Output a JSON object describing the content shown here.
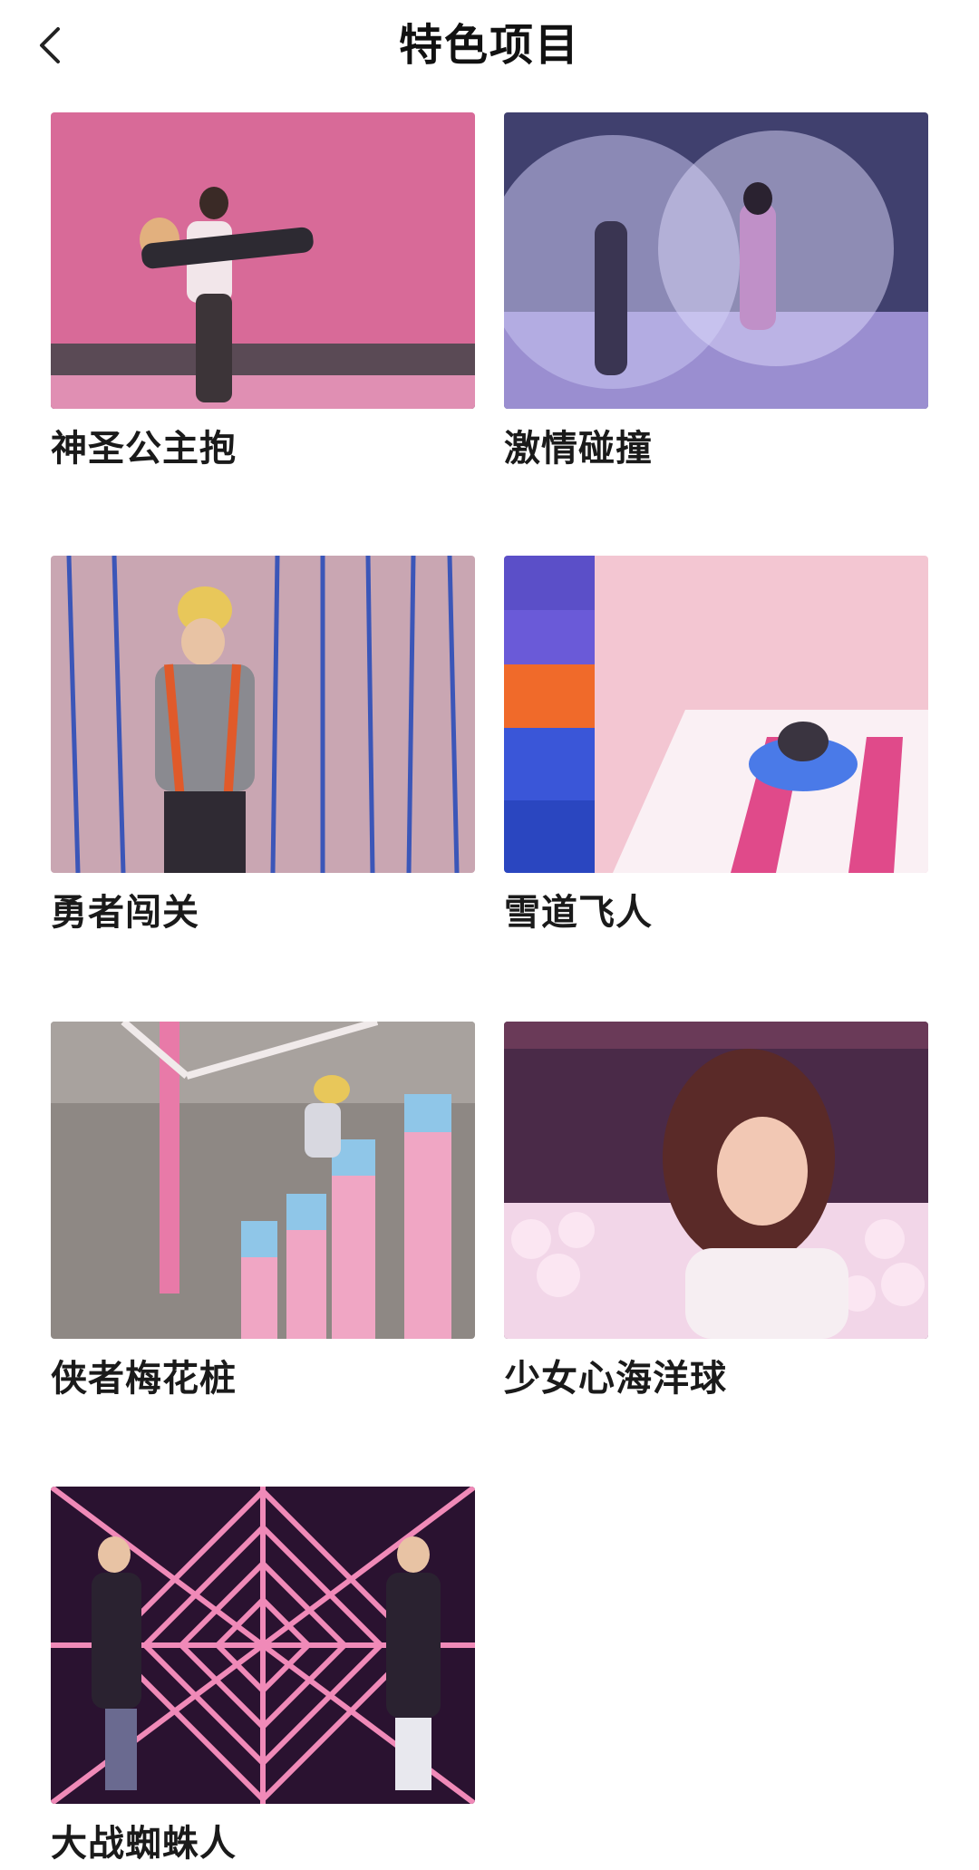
{
  "header": {
    "title": "特色项目",
    "back_icon": "chevron-left-icon"
  },
  "items": [
    {
      "label": "神圣公主抱"
    },
    {
      "label": "激情碰撞"
    },
    {
      "label": "勇者闯关"
    },
    {
      "label": "雪道飞人"
    },
    {
      "label": "侠者梅花桩"
    },
    {
      "label": "少女心海洋球"
    },
    {
      "label": "大战蜘蛛人"
    }
  ],
  "colors": {
    "title": "#111111",
    "label": "#1a1a1a",
    "background": "#ffffff"
  }
}
